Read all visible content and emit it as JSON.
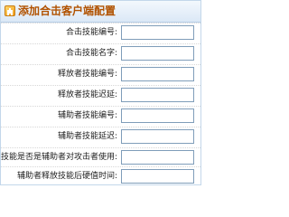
{
  "window": {
    "title": "添加合击客户端配置",
    "title_color": "#b15200",
    "header_bg": "#dbe8f6",
    "icon": "form-icon"
  },
  "form": {
    "fields": [
      {
        "label": "合击技能编号:",
        "value": ""
      },
      {
        "label": "合击技能名字:",
        "value": ""
      },
      {
        "label": "释放者技能编号:",
        "value": ""
      },
      {
        "label": "释放者技能迟延:",
        "value": ""
      },
      {
        "label": "辅助者技能编号:",
        "value": ""
      },
      {
        "label": "辅助者技能延迟:",
        "value": ""
      },
      {
        "label": "技能是否是辅助者对攻击者使用:",
        "value": ""
      },
      {
        "label": "辅助者释放技能后硬值时间:",
        "value": ""
      }
    ]
  }
}
